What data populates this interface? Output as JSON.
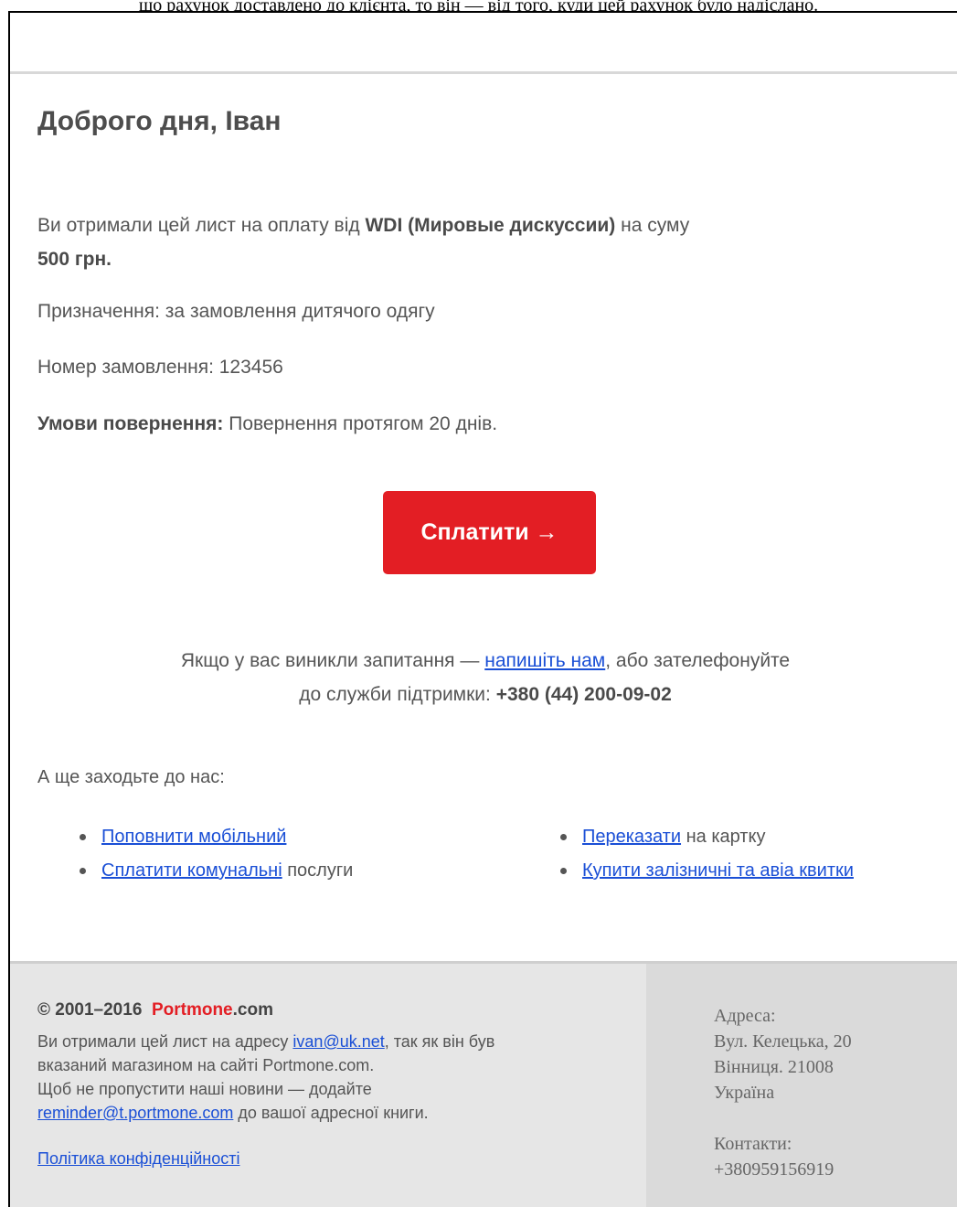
{
  "caption": "що рахунок доставлено до клієнта, то він — від того, куди цей рахунок було надіслано.",
  "greeting": "Доброго дня, Іван",
  "intro": {
    "prefix": "Ви отримали цей лист на оплату від",
    "merchant": "WDI (Мировые дискуссии)",
    "middle": "на суму",
    "amount": "500 грн."
  },
  "purpose": "Призначення: за замовлення дитячого одягу",
  "order": "Номер замовлення: 123456",
  "returns": {
    "label": "Умови повернення:",
    "text": "Повернення протягом 20 днів."
  },
  "pay_button": "Сплатити →",
  "support": {
    "prefix": "Якщо у вас виникли запитання —",
    "link": "напишіть нам",
    "middle": ", або зателефонуйте",
    "line2": "до служби підтримки:",
    "phone": "+380 (44) 200-09-02"
  },
  "also": "А ще заходьте до нас:",
  "links_left": [
    {
      "link": "Поповнити мобільний",
      "rest": ""
    },
    {
      "link": "Сплатити комунальні",
      "rest": " послуги"
    }
  ],
  "links_right": [
    {
      "link": "Переказати",
      "rest": " на картку"
    },
    {
      "link": "Купити залізничні та авіа квитки",
      "rest": ""
    }
  ],
  "footer": {
    "copyright": "© 2001–2016",
    "brand": "Portmone",
    "domain": ".com",
    "line1_prefix": "Ви отримали цей лист на адресу",
    "email": "ivan@uk.net",
    "line1_suffix": ", так як він був",
    "line2": "вказаний магазином на сайті Portmone.com.",
    "line3": "Щоб не пропустити наші новини — додайте",
    "reminder": "reminder@t.portmone.com",
    "line4_suffix": " до вашої адресної книги.",
    "policy": "Політика конфіденційності"
  },
  "address": {
    "label": "Адреса:",
    "street": "Вул. Келецька, 20",
    "city": "Вінниця. 21008",
    "country": "Україна",
    "contacts_label": "Контакти:",
    "phone": "+380959156919"
  },
  "colors": {
    "accent": "#e31e24",
    "link": "#1a4fd6",
    "footer_bg": "#e6e6e6"
  }
}
